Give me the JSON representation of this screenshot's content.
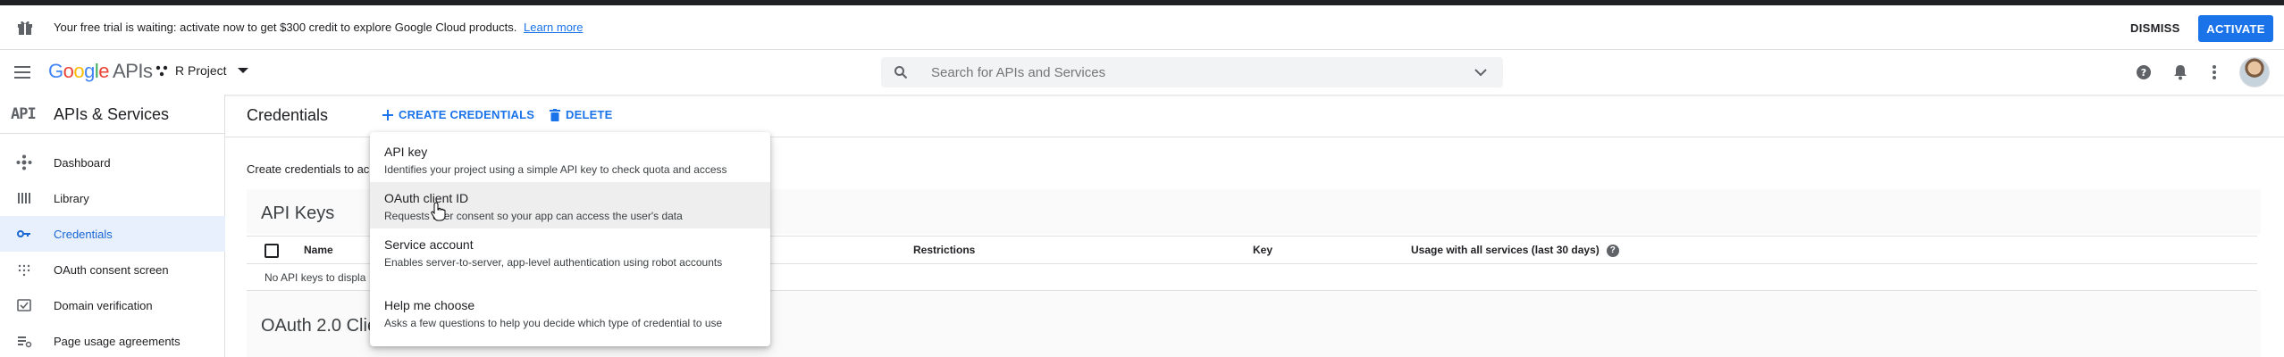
{
  "banner": {
    "message": "Your free trial is waiting: activate now to get $300 credit to explore Google Cloud products.",
    "link": "Learn more",
    "dismiss": "DISMISS",
    "activate": "ACTIVATE"
  },
  "header": {
    "logo_letters": [
      "G",
      "o",
      "o",
      "g",
      "l",
      "e"
    ],
    "logo_suffix": "APIs",
    "project": "R Project",
    "search_placeholder": "Search for APIs and Services"
  },
  "sidebar": {
    "mark": "API",
    "title": "APIs & Services",
    "items": [
      {
        "label": "Dashboard",
        "icon": "dashboard-icon"
      },
      {
        "label": "Library",
        "icon": "library-icon"
      },
      {
        "label": "Credentials",
        "icon": "key-icon",
        "active": true
      },
      {
        "label": "OAuth consent screen",
        "icon": "consent-icon"
      },
      {
        "label": "Domain verification",
        "icon": "domain-check-icon"
      },
      {
        "label": "Page usage agreements",
        "icon": "settings-list-icon"
      }
    ]
  },
  "main": {
    "title": "Credentials",
    "create_label": "CREATE CREDENTIALS",
    "delete_label": "DELETE",
    "intro": "Create credentials to ac",
    "api_keys_title": "API Keys",
    "oauth_title": "OAuth 2.0 Clie",
    "columns": {
      "name": "Name",
      "restrictions": "Restrictions",
      "key": "Key",
      "usage": "Usage with all services (last 30 days)"
    },
    "empty_text": "No API keys to displa"
  },
  "menu": {
    "items": [
      {
        "title": "API key",
        "desc": "Identifies your project using a simple API key to check quota and access"
      },
      {
        "title": "OAuth client ID",
        "desc": "Requests user consent so your app can access the user's data"
      },
      {
        "title": "Service account",
        "desc": "Enables server-to-server, app-level authentication using robot accounts"
      },
      {
        "title": "Help me choose",
        "desc": "Asks a few questions to help you decide which type of credential to use"
      }
    ]
  },
  "colors": {
    "accent": "#1a73e8",
    "active_bg": "#e8f0fe",
    "hover_bg": "#eeeeee"
  }
}
